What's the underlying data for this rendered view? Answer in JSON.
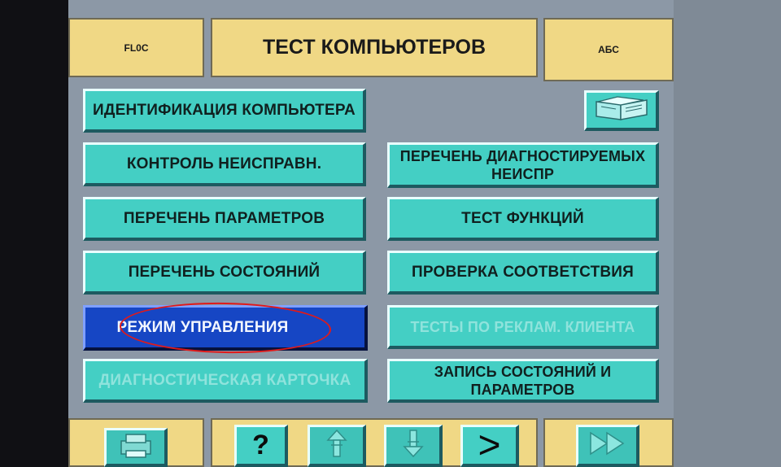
{
  "header": {
    "left_label": "FL0C",
    "title": "ТЕСТ КОМПЬЮТЕРОВ",
    "right_label": "АБС"
  },
  "menu": {
    "identification": "ИДЕНТИФИКАЦИЯ КОМПЬЮТЕРА",
    "fault_control": "КОНТРОЛЬ НЕИСПРАВН.",
    "parameter_list": "ПЕРЕЧЕНЬ ПАРАМЕТРОВ",
    "state_list": "ПЕРЕЧЕНЬ СОСТОЯНИЙ",
    "control_mode": "РЕЖИМ УПРАВЛЕНИЯ",
    "diagnostic_card": "ДИАГНОСТИЧЕСКАЯ КАРТОЧКА",
    "diagnosable_faults": "ПЕРЕЧЕНЬ ДИАГНОСТИРУЕМЫХ НЕИСПР",
    "function_test": "ТЕСТ ФУНКЦИЙ",
    "conformity_check": "ПРОВЕРКА СООТВЕТСТВИЯ",
    "client_complaint_tests": "ТЕСТЫ ПО РЕКЛАМ. КЛИЕНТА",
    "record_states": "ЗАПИСЬ СОСТОЯНИЙ И ПАРАМЕТРОВ"
  },
  "footer": {
    "help_label": "?",
    "next_label": ">"
  },
  "colors": {
    "button_face": "#44cfc4",
    "active_button": "#1646c4",
    "header_yellow": "#f0d885",
    "screen_bg": "#8c98a6",
    "annotation_red": "#e01a1a"
  },
  "icons": {
    "book": "book-icon",
    "printer": "printer-icon",
    "scroll_up": "scroll-up-icon",
    "scroll_down": "scroll-down-icon",
    "fast_forward": "fast-forward-icon"
  }
}
